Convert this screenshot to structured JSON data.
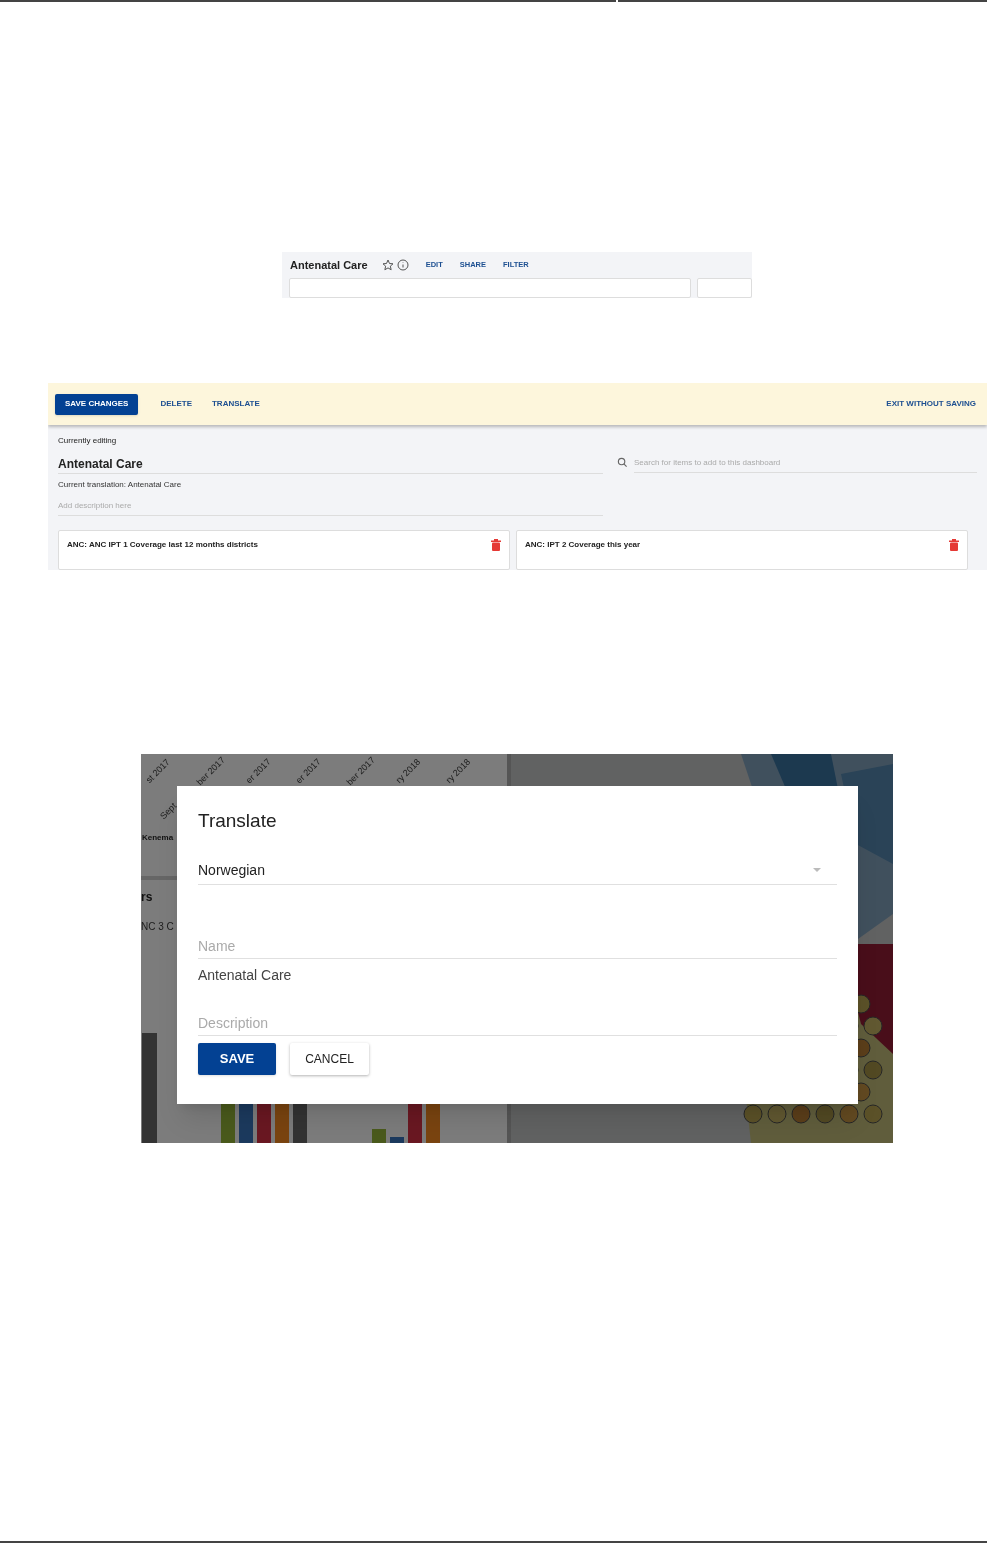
{
  "dashboard_bar": {
    "title": "Antenatal Care",
    "actions": [
      "EDIT",
      "SHARE",
      "FILTER"
    ]
  },
  "edit_bar": {
    "buttons": [
      {
        "label": "SAVE CHANGES",
        "kind": "primary"
      },
      {
        "label": "DELETE",
        "kind": "text"
      },
      {
        "label": "TRANSLATE",
        "kind": "text"
      }
    ],
    "exit": "EXIT WITHOUT SAVING"
  },
  "edit_form": {
    "editing_label": "Currently editing",
    "title": "Antenatal Care",
    "translation": "Current translation: Antenatal Care",
    "description_placeholder": "Add description here",
    "search_placeholder": "Search for items to add to this dashboard"
  },
  "edit_items": [
    "ANC: ANC IPT 1 Coverage last 12 months districts",
    "ANC: IPT 2 Coverage this year"
  ],
  "background": {
    "axis_labels": [
      "st 2017",
      "ber 2017",
      "er 2017",
      "er 2017",
      "ber 2017",
      "ry 2018",
      "ry 2018"
    ],
    "axis_label_lower": "Sept",
    "row_label": "Kenema",
    "heading": "rs",
    "subheading": "NC 3 C"
  },
  "translate_dialog": {
    "title": "Translate",
    "language": "Norwegian",
    "name_placeholder": "Name",
    "name_value": "Antenatal Care",
    "description_placeholder": "Description",
    "buttons": [
      {
        "label": "SAVE",
        "kind": "primary"
      },
      {
        "label": "CANCEL",
        "kind": "secondary"
      }
    ]
  }
}
